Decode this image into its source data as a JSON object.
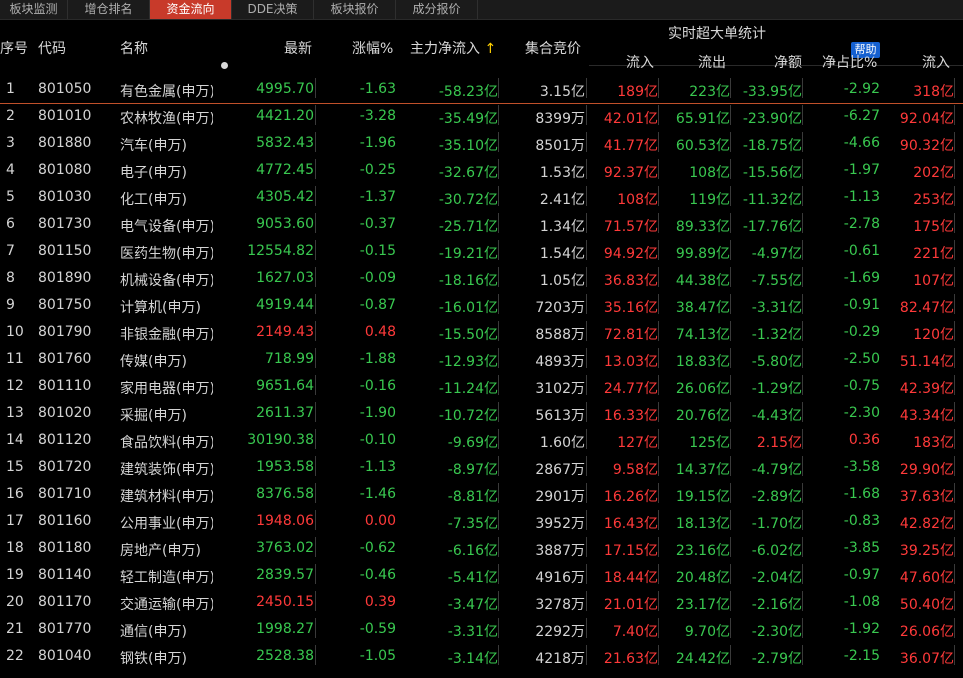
{
  "tabs": [
    "板块监测",
    "增仓排名",
    "资金流向",
    "DDE决策",
    "板块报价",
    "成分报价"
  ],
  "header": {
    "seq": "序号",
    "code": "代码",
    "name": "名称",
    "price": "最新",
    "change": "涨幅%",
    "mainflow": "主力净流入",
    "mainflow_arrow": "↑",
    "auction": "集合竞价",
    "group": "实时超大单统计",
    "help": "帮助",
    "inflow": "流入",
    "outflow": "流出",
    "net": "净额",
    "ratio": "净占比%",
    "inflow2": "流入"
  },
  "colors": {
    "up": "#ff3a3a",
    "down": "#39c850",
    "active_tab": "#c83a2a",
    "help": "#1560d0"
  },
  "rows": [
    {
      "seq": "1",
      "code": "801050",
      "name": "有色金属(申万)",
      "price": "4995.70",
      "change": "-1.63",
      "mainflow": "-58.23亿",
      "auction": "3.15亿",
      "inflow": "189亿",
      "outflow": "223亿",
      "net": "-33.95亿",
      "ratio": "-2.92",
      "inflow2": "318亿"
    },
    {
      "seq": "2",
      "code": "801010",
      "name": "农林牧渔(申万)",
      "price": "4421.20",
      "change": "-3.28",
      "mainflow": "-35.49亿",
      "auction": "8399万",
      "inflow": "42.01亿",
      "outflow": "65.91亿",
      "net": "-23.90亿",
      "ratio": "-6.27",
      "inflow2": "92.04亿"
    },
    {
      "seq": "3",
      "code": "801880",
      "name": "汽车(申万)",
      "price": "5832.43",
      "change": "-1.96",
      "mainflow": "-35.10亿",
      "auction": "8501万",
      "inflow": "41.77亿",
      "outflow": "60.53亿",
      "net": "-18.75亿",
      "ratio": "-4.66",
      "inflow2": "90.32亿"
    },
    {
      "seq": "4",
      "code": "801080",
      "name": "电子(申万)",
      "price": "4772.45",
      "change": "-0.25",
      "mainflow": "-32.67亿",
      "auction": "1.53亿",
      "inflow": "92.37亿",
      "outflow": "108亿",
      "net": "-15.56亿",
      "ratio": "-1.97",
      "inflow2": "202亿"
    },
    {
      "seq": "5",
      "code": "801030",
      "name": "化工(申万)",
      "price": "4305.42",
      "change": "-1.37",
      "mainflow": "-30.72亿",
      "auction": "2.41亿",
      "inflow": "108亿",
      "outflow": "119亿",
      "net": "-11.32亿",
      "ratio": "-1.13",
      "inflow2": "253亿"
    },
    {
      "seq": "6",
      "code": "801730",
      "name": "电气设备(申万)",
      "price": "9053.60",
      "change": "-0.37",
      "mainflow": "-25.71亿",
      "auction": "1.34亿",
      "inflow": "71.57亿",
      "outflow": "89.33亿",
      "net": "-17.76亿",
      "ratio": "-2.78",
      "inflow2": "175亿"
    },
    {
      "seq": "7",
      "code": "801150",
      "name": "医药生物(申万)",
      "price": "12554.82",
      "change": "-0.15",
      "mainflow": "-19.21亿",
      "auction": "1.54亿",
      "inflow": "94.92亿",
      "outflow": "99.89亿",
      "net": "-4.97亿",
      "ratio": "-0.61",
      "inflow2": "221亿"
    },
    {
      "seq": "8",
      "code": "801890",
      "name": "机械设备(申万)",
      "price": "1627.03",
      "change": "-0.09",
      "mainflow": "-18.16亿",
      "auction": "1.05亿",
      "inflow": "36.83亿",
      "outflow": "44.38亿",
      "net": "-7.55亿",
      "ratio": "-1.69",
      "inflow2": "107亿"
    },
    {
      "seq": "9",
      "code": "801750",
      "name": "计算机(申万)",
      "price": "4919.44",
      "change": "-0.87",
      "mainflow": "-16.01亿",
      "auction": "7203万",
      "inflow": "35.16亿",
      "outflow": "38.47亿",
      "net": "-3.31亿",
      "ratio": "-0.91",
      "inflow2": "82.47亿"
    },
    {
      "seq": "10",
      "code": "801790",
      "name": "非银金融(申万)",
      "price": "2149.43",
      "change": "0.48",
      "mainflow": "-15.50亿",
      "auction": "8588万",
      "inflow": "72.81亿",
      "outflow": "74.13亿",
      "net": "-1.32亿",
      "ratio": "-0.29",
      "inflow2": "120亿"
    },
    {
      "seq": "11",
      "code": "801760",
      "name": "传媒(申万)",
      "price": "718.99",
      "change": "-1.88",
      "mainflow": "-12.93亿",
      "auction": "4893万",
      "inflow": "13.03亿",
      "outflow": "18.83亿",
      "net": "-5.80亿",
      "ratio": "-2.50",
      "inflow2": "51.14亿"
    },
    {
      "seq": "12",
      "code": "801110",
      "name": "家用电器(申万)",
      "price": "9651.64",
      "change": "-0.16",
      "mainflow": "-11.24亿",
      "auction": "3102万",
      "inflow": "24.77亿",
      "outflow": "26.06亿",
      "net": "-1.29亿",
      "ratio": "-0.75",
      "inflow2": "42.39亿"
    },
    {
      "seq": "13",
      "code": "801020",
      "name": "采掘(申万)",
      "price": "2611.37",
      "change": "-1.90",
      "mainflow": "-10.72亿",
      "auction": "5613万",
      "inflow": "16.33亿",
      "outflow": "20.76亿",
      "net": "-4.43亿",
      "ratio": "-2.30",
      "inflow2": "43.34亿"
    },
    {
      "seq": "14",
      "code": "801120",
      "name": "食品饮料(申万)",
      "price": "30190.38",
      "change": "-0.10",
      "mainflow": "-9.69亿",
      "auction": "1.60亿",
      "inflow": "127亿",
      "outflow": "125亿",
      "net": "2.15亿",
      "ratio": "0.36",
      "inflow2": "183亿"
    },
    {
      "seq": "15",
      "code": "801720",
      "name": "建筑装饰(申万)",
      "price": "1953.58",
      "change": "-1.13",
      "mainflow": "-8.97亿",
      "auction": "2867万",
      "inflow": "9.58亿",
      "outflow": "14.37亿",
      "net": "-4.79亿",
      "ratio": "-3.58",
      "inflow2": "29.90亿"
    },
    {
      "seq": "16",
      "code": "801710",
      "name": "建筑材料(申万)",
      "price": "8376.58",
      "change": "-1.46",
      "mainflow": "-8.81亿",
      "auction": "2901万",
      "inflow": "16.26亿",
      "outflow": "19.15亿",
      "net": "-2.89亿",
      "ratio": "-1.68",
      "inflow2": "37.63亿"
    },
    {
      "seq": "17",
      "code": "801160",
      "name": "公用事业(申万)",
      "price": "1948.06",
      "change": "0.00",
      "mainflow": "-7.35亿",
      "auction": "3952万",
      "inflow": "16.43亿",
      "outflow": "18.13亿",
      "net": "-1.70亿",
      "ratio": "-0.83",
      "inflow2": "42.82亿"
    },
    {
      "seq": "18",
      "code": "801180",
      "name": "房地产(申万)",
      "price": "3763.02",
      "change": "-0.62",
      "mainflow": "-6.16亿",
      "auction": "3887万",
      "inflow": "17.15亿",
      "outflow": "23.16亿",
      "net": "-6.02亿",
      "ratio": "-3.85",
      "inflow2": "39.25亿"
    },
    {
      "seq": "19",
      "code": "801140",
      "name": "轻工制造(申万)",
      "price": "2839.57",
      "change": "-0.46",
      "mainflow": "-5.41亿",
      "auction": "4916万",
      "inflow": "18.44亿",
      "outflow": "20.48亿",
      "net": "-2.04亿",
      "ratio": "-0.97",
      "inflow2": "47.60亿"
    },
    {
      "seq": "20",
      "code": "801170",
      "name": "交通运输(申万)",
      "price": "2450.15",
      "change": "0.39",
      "mainflow": "-3.47亿",
      "auction": "3278万",
      "inflow": "21.01亿",
      "outflow": "23.17亿",
      "net": "-2.16亿",
      "ratio": "-1.08",
      "inflow2": "50.40亿"
    },
    {
      "seq": "21",
      "code": "801770",
      "name": "通信(申万)",
      "price": "1998.27",
      "change": "-0.59",
      "mainflow": "-3.31亿",
      "auction": "2292万",
      "inflow": "7.40亿",
      "outflow": "9.70亿",
      "net": "-2.30亿",
      "ratio": "-1.92",
      "inflow2": "26.06亿"
    },
    {
      "seq": "22",
      "code": "801040",
      "name": "钢铁(申万)",
      "price": "2528.38",
      "change": "-1.05",
      "mainflow": "-3.14亿",
      "auction": "4218万",
      "inflow": "21.63亿",
      "outflow": "24.42亿",
      "net": "-2.79亿",
      "ratio": "-2.15",
      "inflow2": "36.07亿"
    }
  ]
}
